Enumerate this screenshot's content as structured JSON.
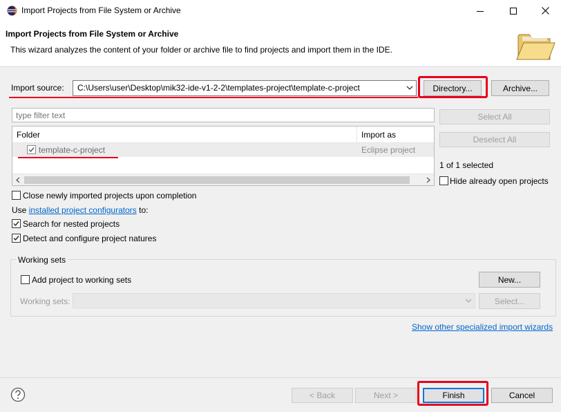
{
  "window": {
    "title": "Import Projects from File System or Archive"
  },
  "banner": {
    "title": "Import Projects from File System or Archive",
    "description": "This wizard analyzes the content of your folder or archive file to find projects and import them in the IDE."
  },
  "import_source": {
    "label": "Import source:",
    "value": "C:\\Users\\user\\Desktop\\mik32-ide-v1-2-2\\templates-project\\template-c-project",
    "directory_button": "Directory...",
    "archive_button": "Archive..."
  },
  "filter": {
    "placeholder": "type filter text"
  },
  "project_table": {
    "columns": [
      "Folder",
      "Import as"
    ],
    "rows": [
      {
        "folder": "template-c-project",
        "import_as": "Eclipse project",
        "checked": true
      }
    ]
  },
  "side_panel": {
    "select_all": "Select All",
    "deselect_all": "Deselect All",
    "selection_count": "1 of 1 selected",
    "hide_open": "Hide already open projects"
  },
  "options": {
    "close_imported": "Close newly imported projects upon completion",
    "use_prefix": "Use ",
    "configurators_link": "installed project configurators",
    "use_suffix": " to:",
    "search_nested": "Search for nested projects",
    "detect_natures": "Detect and configure project natures"
  },
  "working_sets": {
    "group_label": "Working sets",
    "add_label": "Add project to working sets",
    "new_button": "New...",
    "sets_label": "Working sets:",
    "select_button": "Select..."
  },
  "specialized_link": "Show other specialized import wizards",
  "footer": {
    "back": "< Back",
    "next": "Next >",
    "finish": "Finish",
    "cancel": "Cancel"
  },
  "icons": [
    "eclipse-icon",
    "minimize-icon",
    "maximize-icon",
    "close-icon",
    "folder-icon",
    "checkmark-icon",
    "chevron-down-icon",
    "chevron-left-icon",
    "chevron-right-icon",
    "help-icon"
  ],
  "colors": {
    "highlight_red": "#e8001c",
    "link_blue": "#0066cc",
    "default_button_border": "#0078d7"
  }
}
